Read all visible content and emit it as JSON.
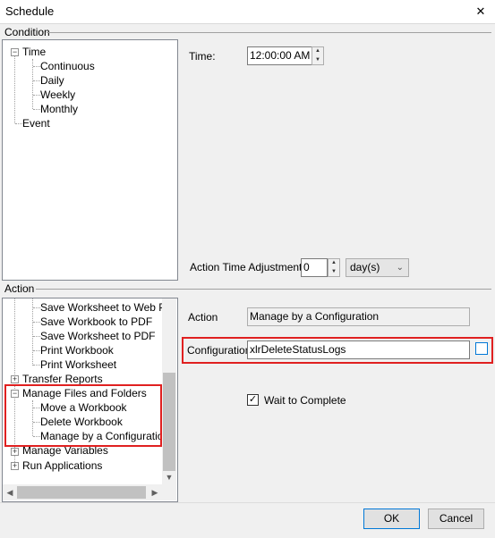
{
  "window": {
    "title": "Schedule",
    "close": "✕"
  },
  "condition": {
    "label": "Condition",
    "tree": {
      "time": "Time",
      "time_children": [
        "Continuous",
        "Daily",
        "Weekly",
        "Monthly"
      ],
      "event": "Event"
    },
    "time_label": "Time:",
    "time_value": "12:00:00 AM",
    "adjust_label": "Action Time Adjustment:",
    "adjust_value": "0",
    "adjust_unit": "day(s)"
  },
  "action": {
    "label": "Action",
    "tree": {
      "items_top": [
        "Save Worksheet to Web Pa",
        "Save Workbook to PDF",
        "Save Worksheet to PDF",
        "Print Workbook",
        "Print Worksheet"
      ],
      "transfer": "Transfer Reports",
      "manage": "Manage Files and Folders",
      "manage_children": [
        "Move a Workbook",
        "Delete Workbook",
        "Manage by a Configuration"
      ],
      "variables": "Manage Variables",
      "run": "Run Applications"
    },
    "action_label": "Action",
    "action_value": "Manage by a Configuration",
    "config_label": "Configuration",
    "config_value": "xlrDeleteStatusLogs",
    "wait_label": "Wait to Complete",
    "wait_checked": "✓"
  },
  "buttons": {
    "ok": "OK",
    "cancel": "Cancel"
  },
  "colors": {
    "highlight": "#e02020",
    "accent": "#0078d7"
  }
}
